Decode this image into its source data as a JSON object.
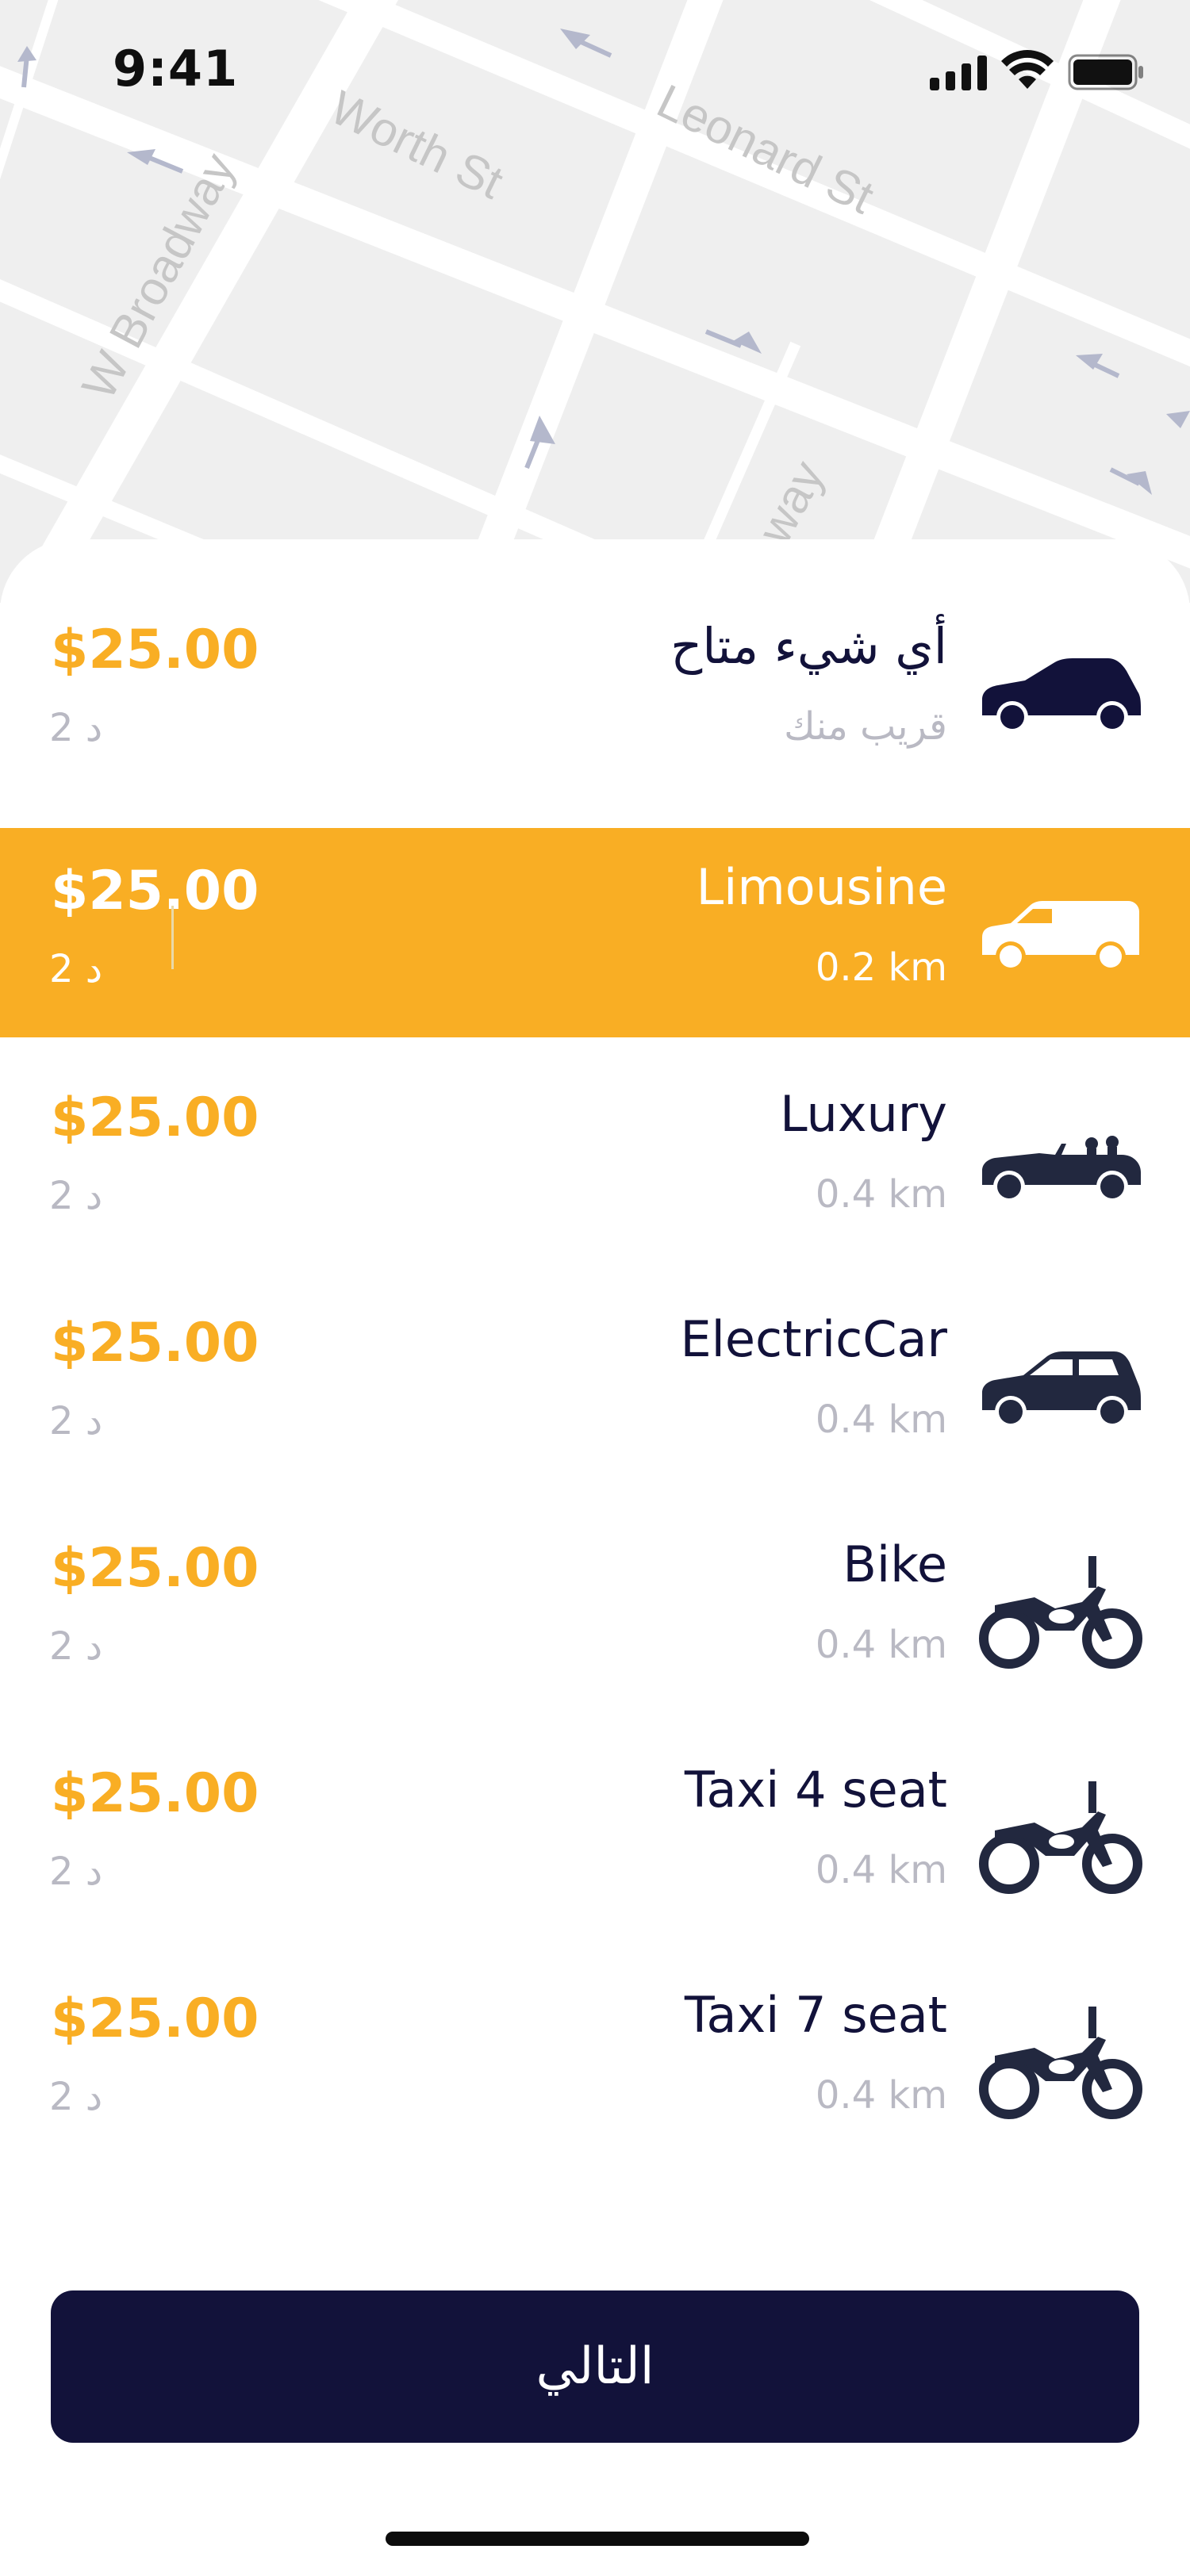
{
  "status_bar": {
    "time": "9:41",
    "icons": [
      "signal-icon",
      "wifi-icon",
      "battery-icon"
    ]
  },
  "map": {
    "street_labels": [
      "Worth St",
      "Leonard St",
      "W Broadway",
      "way"
    ],
    "colors": {
      "background": "#efefef",
      "road": "#ffffff",
      "label": "#c6c6c6",
      "arrow": "#b4b8cc"
    }
  },
  "ride_options": [
    {
      "name": "أي شيء متاح",
      "distance": "قريب منك",
      "price": "$25.00",
      "eta": "2 د",
      "icon": "hatchback-car-icon",
      "selected": false
    },
    {
      "name": "Limousine",
      "distance": "0.2 km",
      "price": "$25.00",
      "eta": "2 د",
      "icon": "van-icon",
      "selected": true
    },
    {
      "name": "Luxury",
      "distance": "0.4 km",
      "price": "$25.00",
      "eta": "2 د",
      "icon": "convertible-car-icon",
      "selected": false
    },
    {
      "name": "ElectricCar",
      "distance": "0.4 km",
      "price": "$25.00",
      "eta": "2 د",
      "icon": "compact-car-icon",
      "selected": false
    },
    {
      "name": "Bike",
      "distance": "0.4 km",
      "price": "$25.00",
      "eta": "2 د",
      "icon": "motorbike-icon",
      "selected": false
    },
    {
      "name": "Taxi 4 seat",
      "distance": "0.4 km",
      "price": "$25.00",
      "eta": "2 د",
      "icon": "motorbike-icon",
      "selected": false
    },
    {
      "name": "Taxi 7 seat",
      "distance": "0.4 km",
      "price": "$25.00",
      "eta": "2 د",
      "icon": "motorbike-icon",
      "selected": false
    }
  ],
  "next_button": {
    "label": "التالي"
  },
  "colors": {
    "accent": "#f9ae24",
    "primary": "#12123a",
    "muted": "#b9b9c3",
    "sheet": "#ffffff"
  }
}
